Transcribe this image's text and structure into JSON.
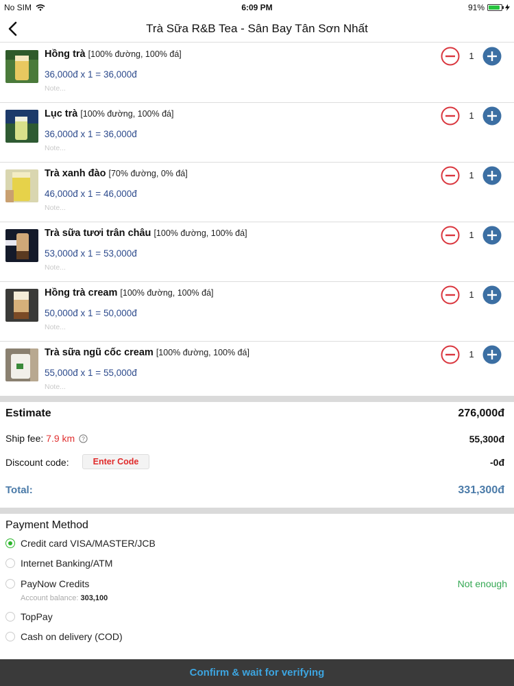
{
  "status_bar": {
    "carrier": "No SIM",
    "time": "6:09 PM",
    "battery": "91%",
    "battery_fraction": 0.91
  },
  "nav": {
    "title": "Trà Sữa R&B Tea - Sân Bay Tân Sơn Nhất"
  },
  "cart": {
    "items": [
      {
        "name": "Hồng trà",
        "options": "[100% đường, 100% đá]",
        "price_line": "36,000đ  x 1 = 36,000đ",
        "note_placeholder": "Note...",
        "quantity": "1"
      },
      {
        "name": "Lục trà",
        "options": "[100% đường, 100% đá]",
        "price_line": "36,000đ  x 1 = 36,000đ",
        "note_placeholder": "Note...",
        "quantity": "1"
      },
      {
        "name": "Trà xanh đào",
        "options": "[70% đường, 0% đá]",
        "price_line": "46,000đ  x 1 = 46,000đ",
        "note_placeholder": "Note...",
        "quantity": "1"
      },
      {
        "name": "Trà sữa tươi trân châu",
        "options": "[100% đường, 100% đá]",
        "price_line": "53,000đ  x 1 = 53,000đ",
        "note_placeholder": "Note...",
        "quantity": "1"
      },
      {
        "name": "Hồng trà cream",
        "options": "[100% đường, 100% đá]",
        "price_line": "50,000đ  x 1 = 50,000đ",
        "note_placeholder": "Note...",
        "quantity": "1"
      },
      {
        "name": "Trà sữa ngũ cốc cream",
        "options": "[100% đường, 100% đá]",
        "price_line": "55,000đ  x 1 = 55,000đ",
        "note_placeholder": "Note...",
        "quantity": "1"
      }
    ]
  },
  "summary": {
    "estimate_label": "Estimate",
    "estimate_value": "276,000đ",
    "ship_fee_label": "Ship fee:",
    "ship_distance": "7.9 km",
    "ship_fee_value": "55,300đ",
    "discount_label": "Discount code:",
    "enter_code_label": "Enter Code",
    "discount_value": "-0đ",
    "total_label": "Total:",
    "total_value": "331,300đ"
  },
  "payment": {
    "title": "Payment Method",
    "methods": [
      {
        "label": "Credit card VISA/MASTER/JCB",
        "selected": true
      },
      {
        "label": "Internet Banking/ATM",
        "selected": false
      },
      {
        "label": "PayNow Credits",
        "selected": false
      },
      {
        "label": "TopPay",
        "selected": false
      },
      {
        "label": "Cash on delivery (COD)",
        "selected": false
      }
    ],
    "paynow_status": "Not enough",
    "balance_label": "Account balance:",
    "balance_value": "303,100"
  },
  "confirm_button": {
    "label": "Confirm & wait for verifying"
  },
  "colors": {
    "minus_red": "#d9363e",
    "plus_blue": "#3c6fa3",
    "total_blue": "#4a7aa8",
    "confirm_text": "#3da5e0",
    "selected_green": "#2bb52b"
  }
}
